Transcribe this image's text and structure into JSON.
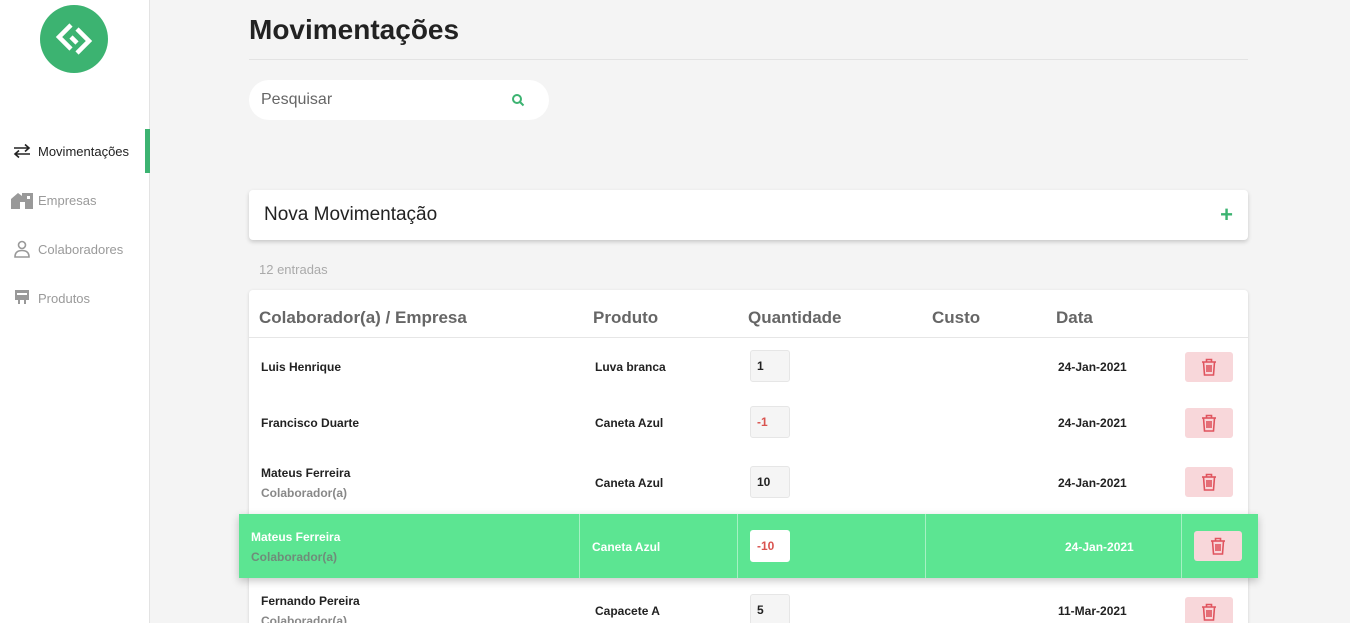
{
  "sidebar": {
    "items": [
      {
        "label": "Movimentações",
        "icon": "swap-arrows-icon",
        "active": true
      },
      {
        "label": "Empresas",
        "icon": "buildings-icon",
        "active": false
      },
      {
        "label": "Colaboradores",
        "icon": "person-icon",
        "active": false
      },
      {
        "label": "Produtos",
        "icon": "product-icon",
        "active": false
      }
    ]
  },
  "header": {
    "title": "Movimentações"
  },
  "search": {
    "placeholder": "Pesquisar"
  },
  "new_movement": {
    "label": "Nova Movimentação",
    "add_symbol": "+"
  },
  "entries_count": "12 entradas",
  "table": {
    "columns": [
      "Colaborador(a) / Empresa",
      "Produto",
      "Quantidade",
      "Custo",
      "Data"
    ],
    "rows": [
      {
        "name": "Luis Henrique",
        "role": "",
        "product": "Luva branca",
        "quantity": "1",
        "cost": "",
        "date": "24-Jan-2021"
      },
      {
        "name": "Francisco Duarte",
        "role": "",
        "product": "Caneta Azul",
        "quantity": "-1",
        "cost": "",
        "date": "24-Jan-2021"
      },
      {
        "name": "Mateus Ferreira",
        "role": "Colaborador(a)",
        "product": "Caneta Azul",
        "quantity": "10",
        "cost": "",
        "date": "24-Jan-2021"
      },
      {
        "name": "Fernando Pereira",
        "role": "Colaborador(a)",
        "product": "Capacete A",
        "quantity": "5",
        "cost": "",
        "date": "11-Mar-2021"
      }
    ],
    "dragging_row": {
      "name": "Mateus Ferreira",
      "role": "Colaborador(a)",
      "product": "Caneta Azul",
      "quantity": "-10",
      "cost": "",
      "date": "24-Jan-2021"
    }
  },
  "colors": {
    "accent": "#3cb371",
    "drag_highlight": "#5ce592",
    "delete_bg": "#f8d7da",
    "delete_icon": "#e0545e",
    "negative": "#d9534f"
  }
}
